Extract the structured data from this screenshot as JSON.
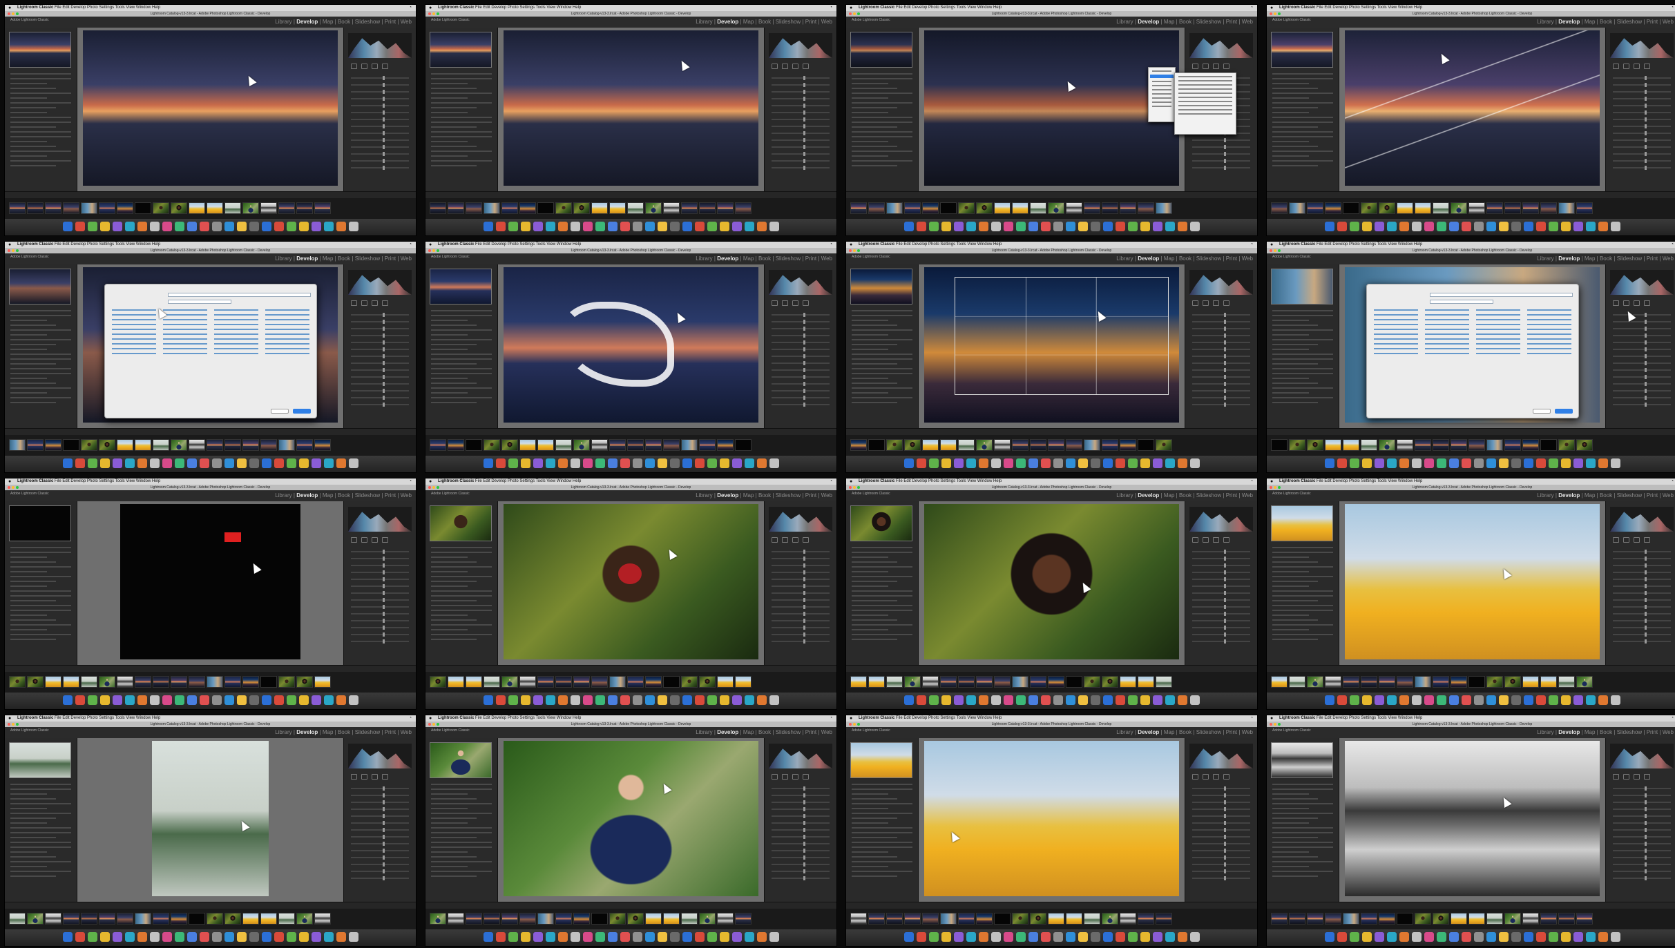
{
  "app": {
    "menubar_app": "Lightroom Classic",
    "menubar_items": [
      "File",
      "Edit",
      "Develop",
      "Photo",
      "Settings",
      "Tools",
      "View",
      "Window",
      "Help"
    ],
    "window_title": "Lightroom Catalog-v13-3.lrcat - Adobe Photoshop Lightroom Classic - Develop",
    "identity_plate": "Adobe Lightroom Classic",
    "modules": [
      "Library",
      "Develop",
      "Map",
      "Book",
      "Slideshow",
      "Print",
      "Web"
    ],
    "active_module": "Develop"
  },
  "dock_colors": [
    "#2b6fd6",
    "#d94a3a",
    "#5fb34a",
    "#e6b82e",
    "#8a5cd6",
    "#2aa7c7",
    "#e07830",
    "#c2c2c2",
    "#d84a8a",
    "#3cb878",
    "#4a7fe0",
    "#e05050",
    "#909090",
    "#2f8fd8",
    "#f0c040",
    "#6a6a6a"
  ],
  "tiles": [
    {
      "scene": "pier-sunset",
      "overlay": "none"
    },
    {
      "scene": "pier-sunset",
      "overlay": "none"
    },
    {
      "scene": "pier-dim",
      "overlay": "dropdown"
    },
    {
      "scene": "pier-gradient",
      "overlay": "gradient-lines"
    },
    {
      "scene": "pier-dialog",
      "overlay": "dialog"
    },
    {
      "scene": "pier-lightpainting",
      "overlay": "brush-strokes"
    },
    {
      "scene": "city-night",
      "overlay": "crop-grid"
    },
    {
      "scene": "pier-dialog-2",
      "overlay": "dialog"
    },
    {
      "scene": "black-mask",
      "overlay": "red-mark"
    },
    {
      "scene": "portrait-red-lips",
      "overlay": "lip-mask"
    },
    {
      "scene": "portrait-woman-afro",
      "overlay": "none"
    },
    {
      "scene": "woman-hat-yellow-chairs",
      "overlay": "none"
    },
    {
      "scene": "woman-floral-dress",
      "overlay": "none"
    },
    {
      "scene": "man-sunglasses",
      "overlay": "none"
    },
    {
      "scene": "woman-hat-yellow-chairs-2",
      "overlay": "none"
    },
    {
      "scene": "bw-mountain-lake",
      "overlay": "none"
    }
  ]
}
